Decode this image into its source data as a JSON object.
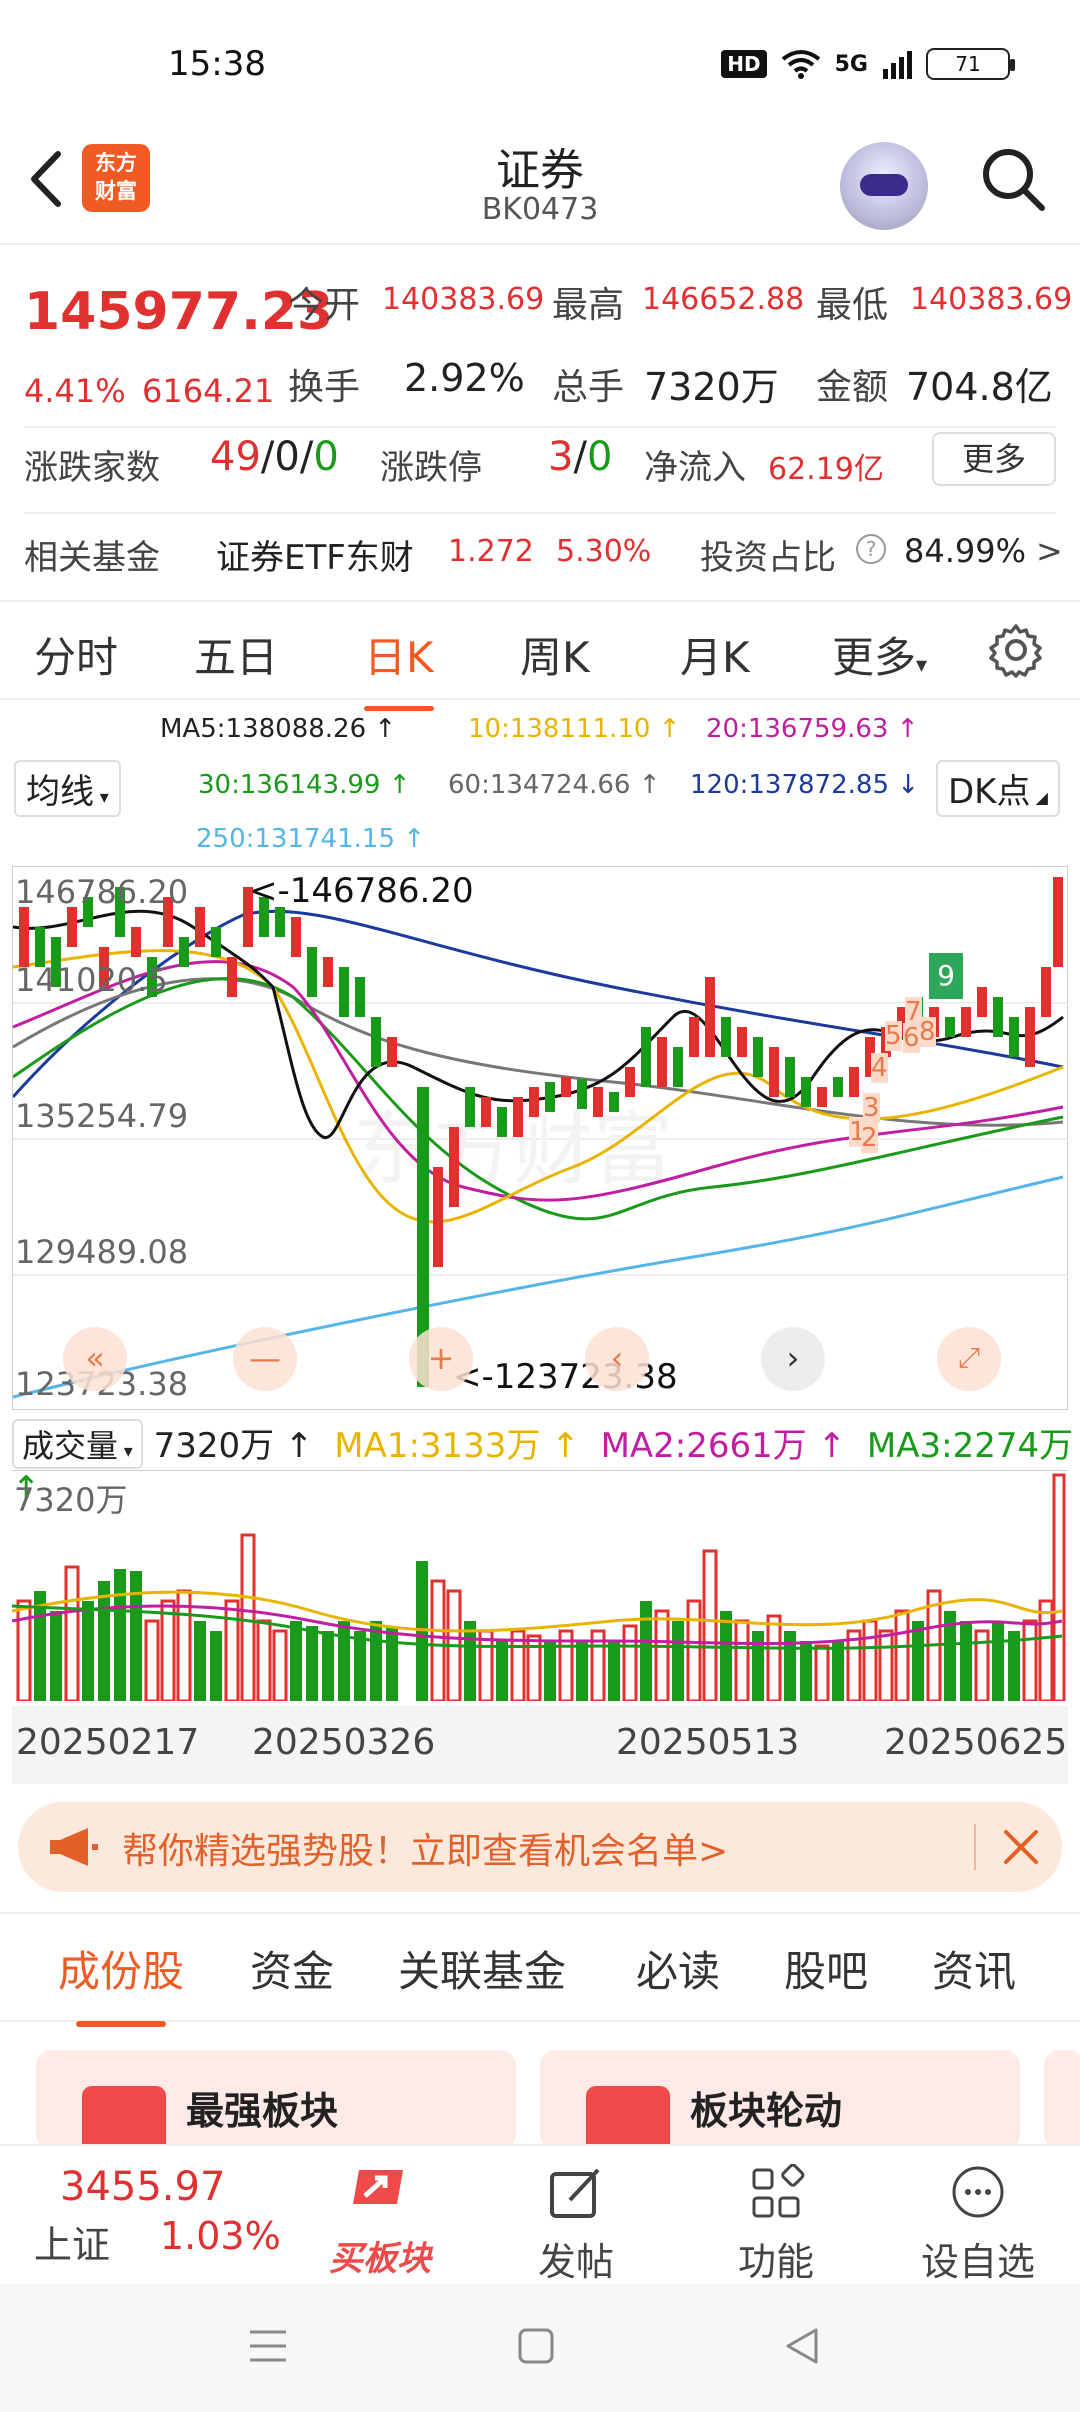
{
  "status": {
    "time": "15:38",
    "hd": "HD",
    "net": "5G",
    "battery": "71"
  },
  "header": {
    "title": "证券",
    "code": "BK0473",
    "logo_line1": "东方",
    "logo_line2": "财富"
  },
  "quote": {
    "price": "145977.23",
    "pct": "4.41%",
    "change": "6164.21",
    "open_label": "今开",
    "open": "140383.69",
    "high_label": "最高",
    "high": "146652.88",
    "low_label": "最低",
    "low": "140383.69",
    "turnover_label": "换手",
    "turnover": "2.92%",
    "volume_label": "总手",
    "volume": "7320万",
    "amount_label": "金额",
    "amount": "704.8亿",
    "breadth_label": "涨跌家数",
    "breadth_up": "49",
    "breadth_sep1": "/",
    "breadth_flat": "0",
    "breadth_sep2": "/",
    "breadth_down": "0",
    "limit_label": "涨跌停",
    "limit_up": "3",
    "limit_sep": "/",
    "limit_down": "0",
    "netflow_label": "净流入",
    "netflow": "62.19亿",
    "more_label": "更多"
  },
  "fund": {
    "label": "相关基金",
    "name": "证券ETF东财",
    "price": "1.272",
    "pct": "5.30%",
    "ratio_label": "投资占比",
    "ratio": "84.99%",
    "arrow": ">"
  },
  "period_tabs": [
    "分时",
    "五日",
    "日K",
    "周K",
    "月K",
    "更多"
  ],
  "period_active": 2,
  "ma": {
    "ma5": "MA5:138088.26",
    "ma10": "10:138111.10",
    "ma20": "20:136759.63",
    "ma30": "30:136143.99",
    "ma60": "60:134724.66",
    "ma120": "120:137872.85",
    "ma250": "250:131741.15",
    "ma_select": "均线",
    "dk_label": "DK点"
  },
  "chart_labels": {
    "y_top": "146786.20",
    "y_mid1": "141020.5",
    "y_mid2": "135254.79",
    "y_mid3": "129489.08",
    "y_bot": "123723.38",
    "hi_note": "<-146786.20",
    "lo_note": "<-123723.38",
    "marks": [
      "9",
      "7",
      "8",
      "5",
      "6",
      "4",
      "3",
      "1",
      "2"
    ]
  },
  "volume": {
    "select": "成交量",
    "value": "7320万",
    "ma1": "MA1:3133万",
    "ma2": "MA2:2661万",
    "ma3": "MA3:2274万",
    "axis_top": "7320万"
  },
  "dates": [
    "20250217",
    "20250326",
    "20250513",
    "20250625"
  ],
  "banner": {
    "text": "帮你精选强势股！立即查看机会名单>"
  },
  "content_tabs": [
    "成份股",
    "资金",
    "关联基金",
    "必读",
    "股吧",
    "资讯"
  ],
  "content_active": 0,
  "cards": [
    {
      "title": "最强板块"
    },
    {
      "title": "板块轮动"
    }
  ],
  "bottom": {
    "index_value": "3455.97",
    "index_name": "上证",
    "index_pct": "1.03%",
    "buy": "买板块",
    "post": "发帖",
    "func": "功能",
    "watch": "设自选"
  },
  "colors": {
    "accent": "#f05b24",
    "up": "#e03030",
    "down": "#1a9a1a"
  }
}
